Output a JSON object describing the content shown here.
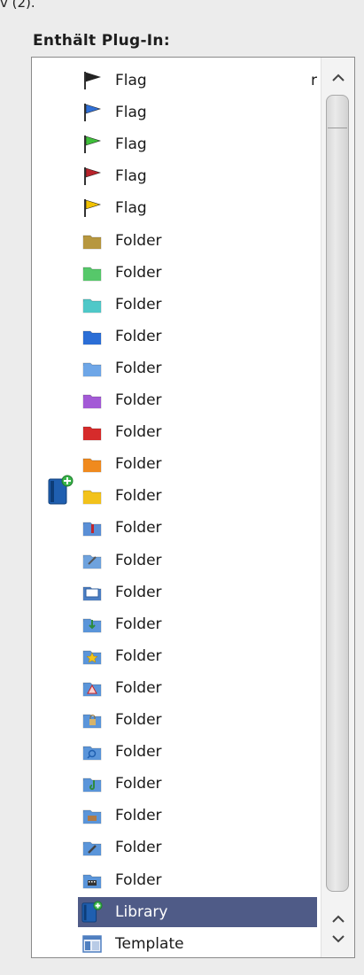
{
  "top_fragment": "v (2).",
  "section_title": "Enthält Plug-In:",
  "list": {
    "items": [
      {
        "label": "Flag",
        "icon": "flag-black",
        "color": "#222222",
        "tail": "r"
      },
      {
        "label": "Flag",
        "icon": "flag-blue",
        "color": "#2f6fd6"
      },
      {
        "label": "Flag",
        "icon": "flag-green",
        "color": "#3fbf3a"
      },
      {
        "label": "Flag",
        "icon": "flag-red",
        "color": "#b8232b"
      },
      {
        "label": "Flag",
        "icon": "flag-yellow",
        "color": "#f2c200"
      },
      {
        "label": "Folder",
        "icon": "folder-olive",
        "color": "#b7973f"
      },
      {
        "label": "Folder",
        "icon": "folder-green",
        "color": "#56c86a"
      },
      {
        "label": "Folder",
        "icon": "folder-teal",
        "color": "#4fc8c8"
      },
      {
        "label": "Folder",
        "icon": "folder-blue",
        "color": "#2b6fd6"
      },
      {
        "label": "Folder",
        "icon": "folder-lightblue",
        "color": "#6ea6e6"
      },
      {
        "label": "Folder",
        "icon": "folder-purple",
        "color": "#a35ad6"
      },
      {
        "label": "Folder",
        "icon": "folder-red",
        "color": "#d62b2b"
      },
      {
        "label": "Folder",
        "icon": "folder-orange",
        "color": "#f08a1e"
      },
      {
        "label": "Folder",
        "icon": "folder-yellow",
        "color": "#f2c21b"
      },
      {
        "label": "Folder",
        "icon": "folder-bookmark",
        "color": "#5a8fd6"
      },
      {
        "label": "Folder",
        "icon": "folder-tools",
        "color": "#6fa2dd"
      },
      {
        "label": "Folder",
        "icon": "folder-window",
        "color": "#4c7fc4"
      },
      {
        "label": "Folder",
        "icon": "folder-download",
        "color": "#5b95d9"
      },
      {
        "label": "Folder",
        "icon": "folder-star",
        "color": "#5b95d9"
      },
      {
        "label": "Folder",
        "icon": "folder-apps",
        "color": "#5b95d9"
      },
      {
        "label": "Folder",
        "icon": "folder-locked",
        "color": "#5b95d9"
      },
      {
        "label": "Folder",
        "icon": "folder-search",
        "color": "#5b95d9"
      },
      {
        "label": "Folder",
        "icon": "folder-music",
        "color": "#5b95d9"
      },
      {
        "label": "Folder",
        "icon": "folder-briefcase",
        "color": "#5b95d9"
      },
      {
        "label": "Folder",
        "icon": "folder-edit",
        "color": "#5b95d9"
      },
      {
        "label": "Folder",
        "icon": "folder-movies",
        "color": "#5b95d9"
      },
      {
        "label": "Library",
        "icon": "library-add",
        "color": "#1f5fb0",
        "selected": true
      },
      {
        "label": "Template",
        "icon": "template",
        "color": "#4f7fc0"
      }
    ]
  },
  "colors": {
    "selection": "#4f5b87",
    "panel_bg": "#ffffff",
    "page_bg": "#ececec"
  }
}
